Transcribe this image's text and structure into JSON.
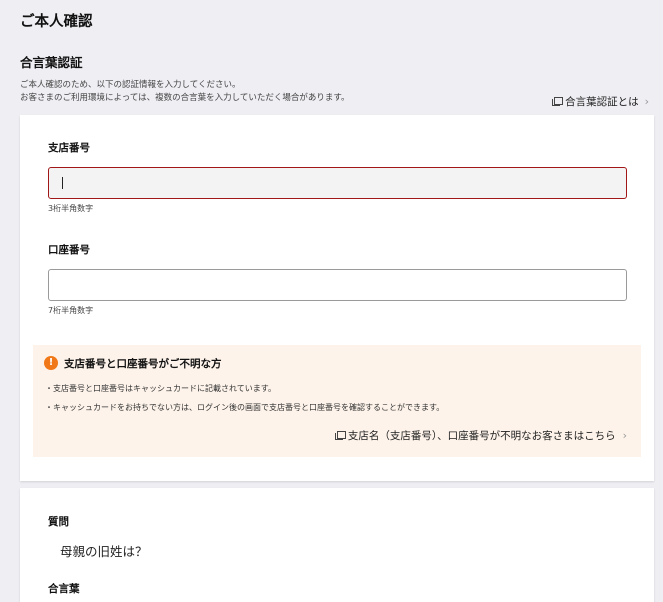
{
  "page": {
    "title": "ご本人確認"
  },
  "section": {
    "title": "合言葉認証",
    "description_line1": "ご本人確認のため、以下の認証情報を入力してください。",
    "description_line2": "お客さまのご利用環境によっては、複数の合言葉を入力していただく場合があります。",
    "help_link": "合言葉認証とは"
  },
  "form": {
    "branch": {
      "label": "支店番号",
      "value": "",
      "hint": "3桁半角数字"
    },
    "account": {
      "label": "口座番号",
      "value": "",
      "hint": "7桁半角数字"
    }
  },
  "notice": {
    "icon": "!",
    "title": "支店番号と口座番号がご不明な方",
    "line1": "・支店番号と口座番号はキャッシュカードに記載されています。",
    "line2": "・キャッシュカードをお持ちでない方は、ログイン後の画面で支店番号と口座番号を確認することができます。",
    "link": "支店名（支店番号）、口座番号が不明なお客さまはこちら"
  },
  "secret": {
    "question_label": "質問",
    "question_text": "母親の旧姓は？",
    "answer_label": "合言葉"
  },
  "colors": {
    "background": "#eeeef3",
    "error_border": "#a11616",
    "notice_bg": "#fdf3ea",
    "notice_icon": "#f07818"
  }
}
